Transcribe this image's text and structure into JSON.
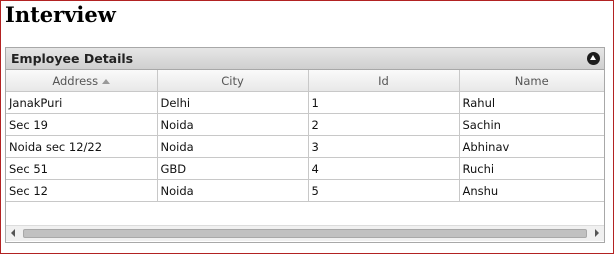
{
  "page": {
    "title": "Interview"
  },
  "grid": {
    "title": "Employee Details",
    "columns": [
      "Address",
      "City",
      "Id",
      "Name"
    ],
    "sorted_column": "Address",
    "sort_direction": "ascending",
    "rows": [
      [
        "JanakPuri",
        "Delhi",
        "1",
        "Rahul"
      ],
      [
        "Sec 19",
        "Noida",
        "2",
        "Sachin"
      ],
      [
        "Noida sec 12/22",
        "Noida",
        "3",
        "Abhinav"
      ],
      [
        "Sec 51",
        "GBD",
        "4",
        "Ruchi"
      ],
      [
        "Sec 12",
        "Noida",
        "5",
        "Anshu"
      ]
    ]
  },
  "icons": {
    "collapse": "collapse-up-icon",
    "sort": "sort-ascending-icon",
    "scroll_left": "scroll-left-icon",
    "scroll_right": "scroll-right-icon"
  },
  "colors": {
    "frame_border": "#b22222",
    "header_bg": "#d9d9d9"
  }
}
